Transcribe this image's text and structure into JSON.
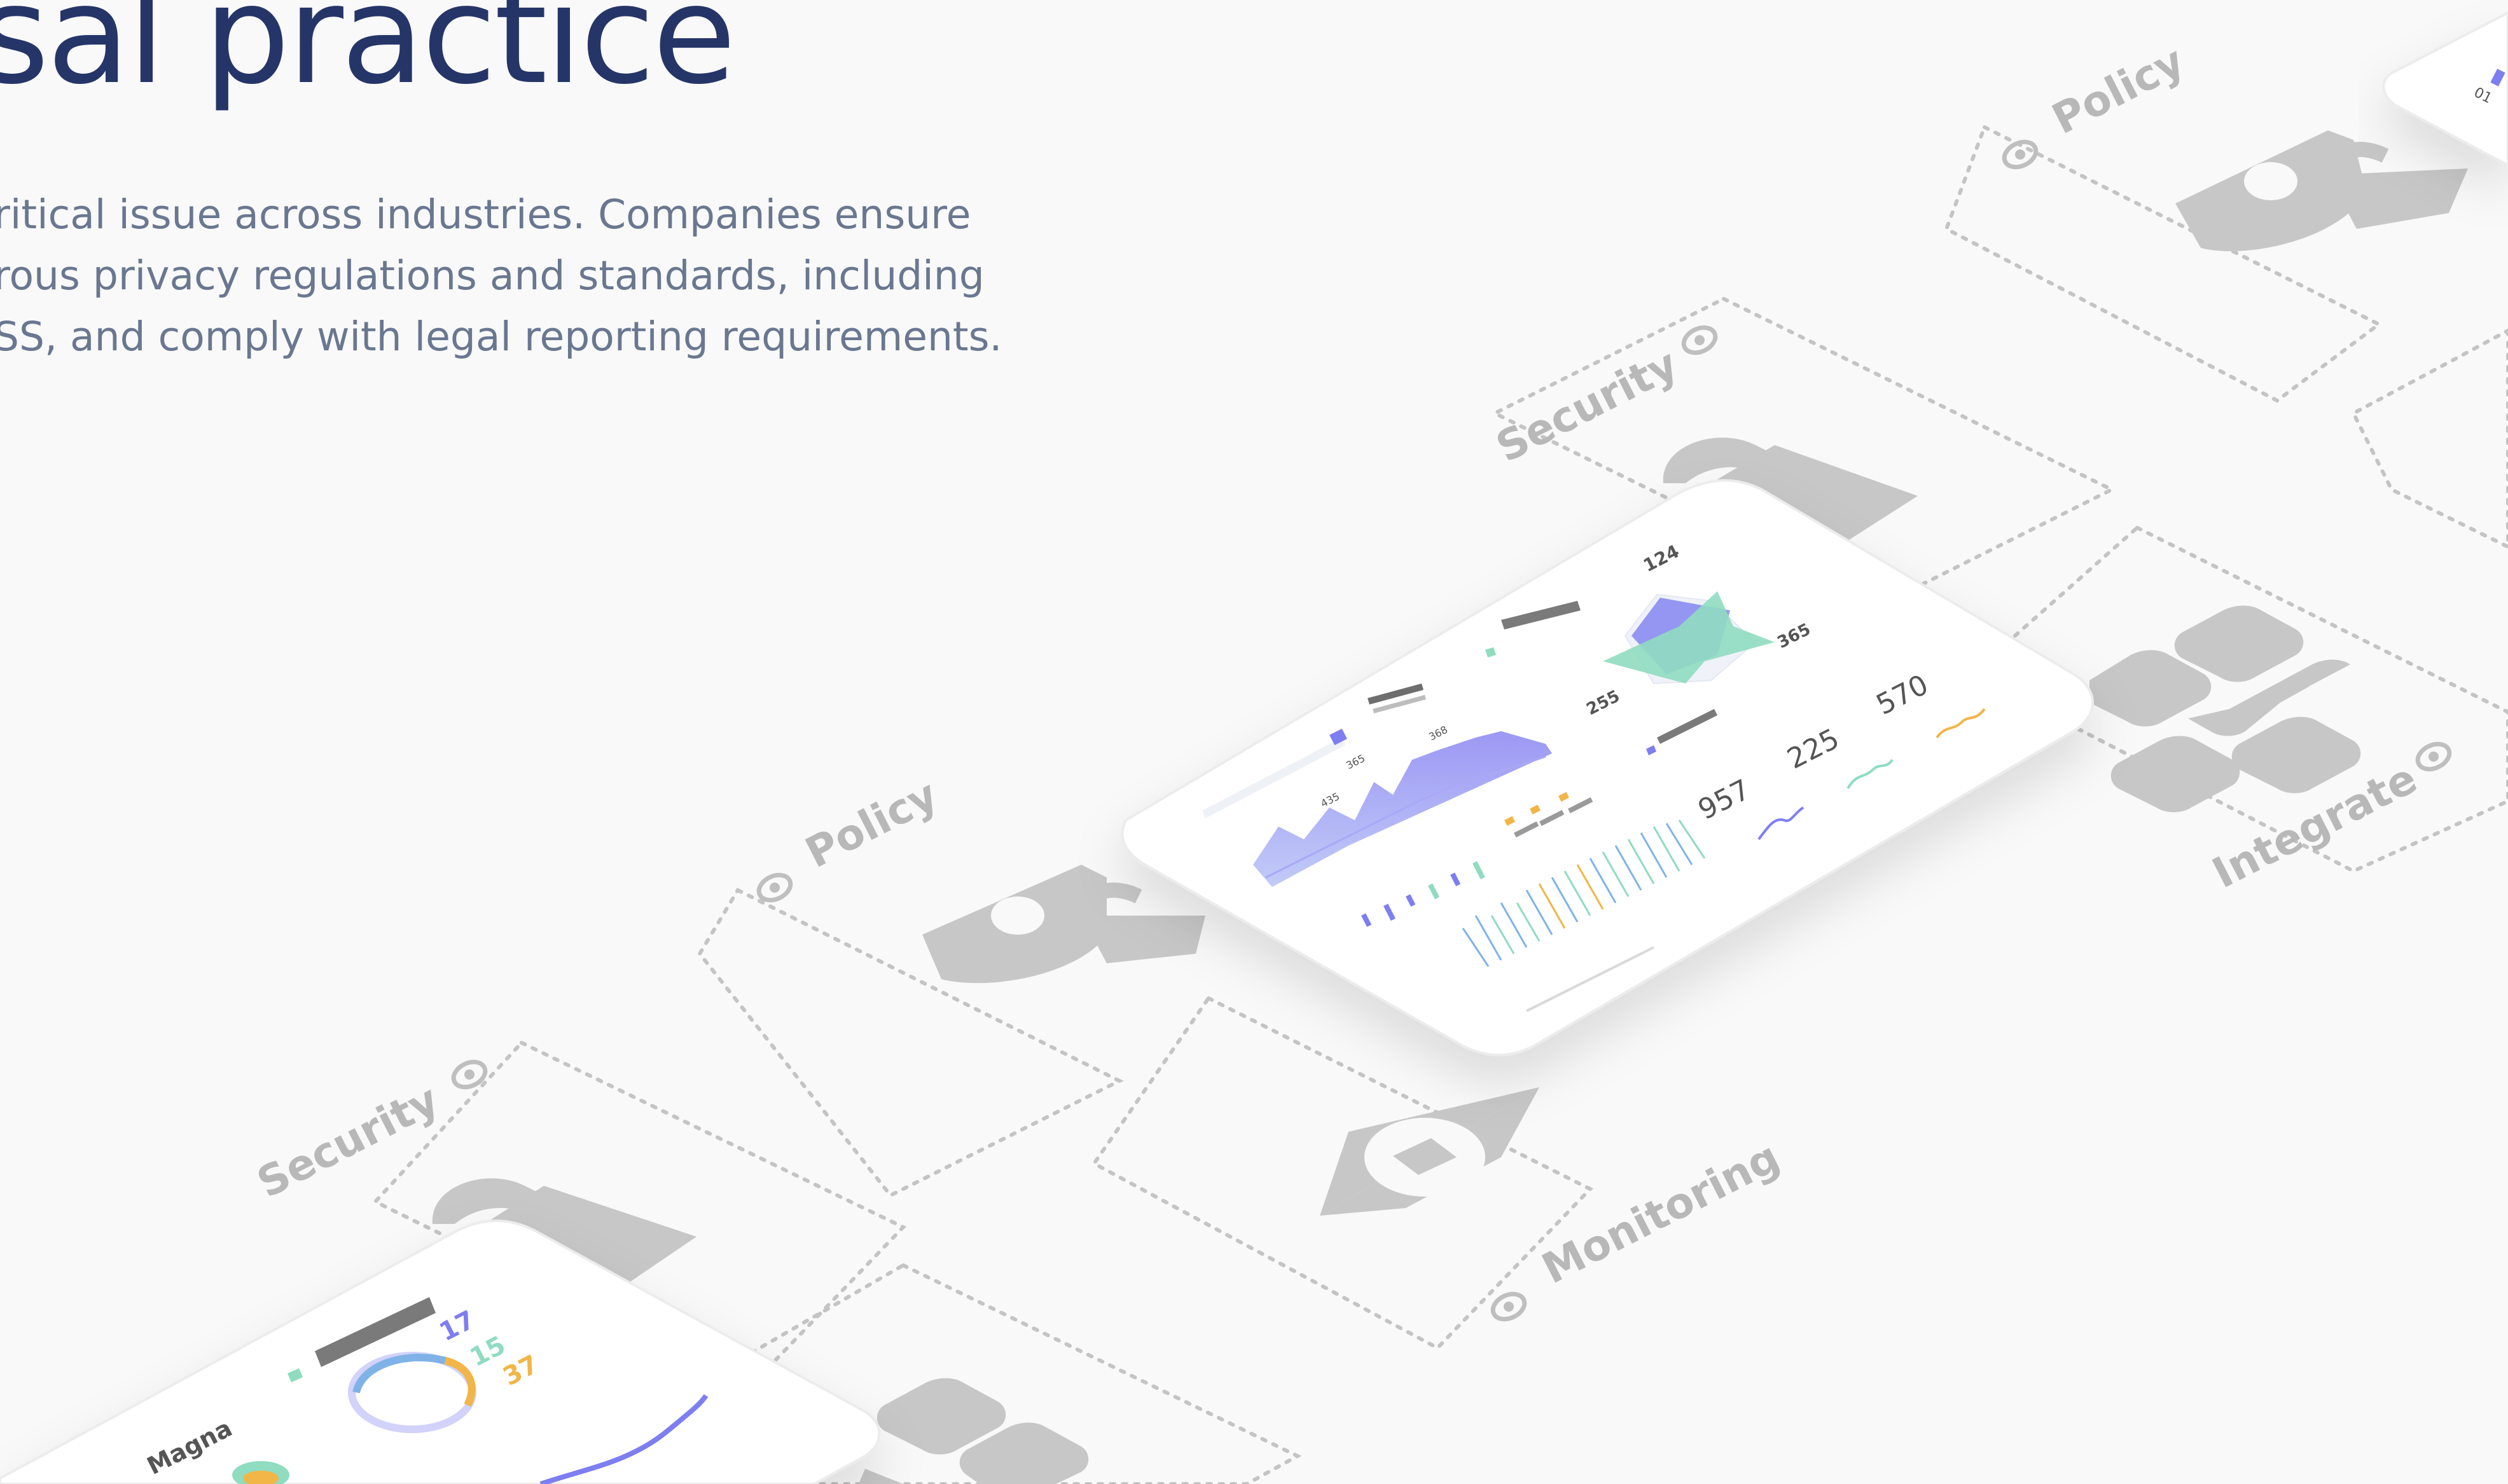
{
  "hero": {
    "headline": "sal practice",
    "body_lines": [
      "ritical issue across industries. Companies ensure",
      "rous privacy regulations and standards, including",
      "SS, and comply with legal reporting requirements."
    ]
  },
  "steps": {
    "security_main": "Security",
    "policy_main": "Policy",
    "monitoring": "Monitoring",
    "integrate": "Integrate",
    "security_lower": "Security",
    "policy_top": "Policy"
  },
  "dashboard_main": {
    "stat_124": "124",
    "stat_365": "365",
    "stat_255": "255",
    "stat_957": "957",
    "stat_225": "225",
    "stat_570": "570",
    "chart_435": "435",
    "chart_365": "365",
    "chart_368": "368"
  },
  "dashboard_lower": {
    "title": "Magna",
    "stat_17": "17",
    "stat_15": "15",
    "stat_37": "37"
  },
  "dashboard_corner": {
    "label": "01"
  },
  "colors": {
    "headline": "#263568",
    "body_text": "#6a7790",
    "icon_gray": "#c7c7c7",
    "chart_purple": "#7d7ef0",
    "chart_mint": "#8fdcc0",
    "chart_amber": "#f2b548"
  }
}
